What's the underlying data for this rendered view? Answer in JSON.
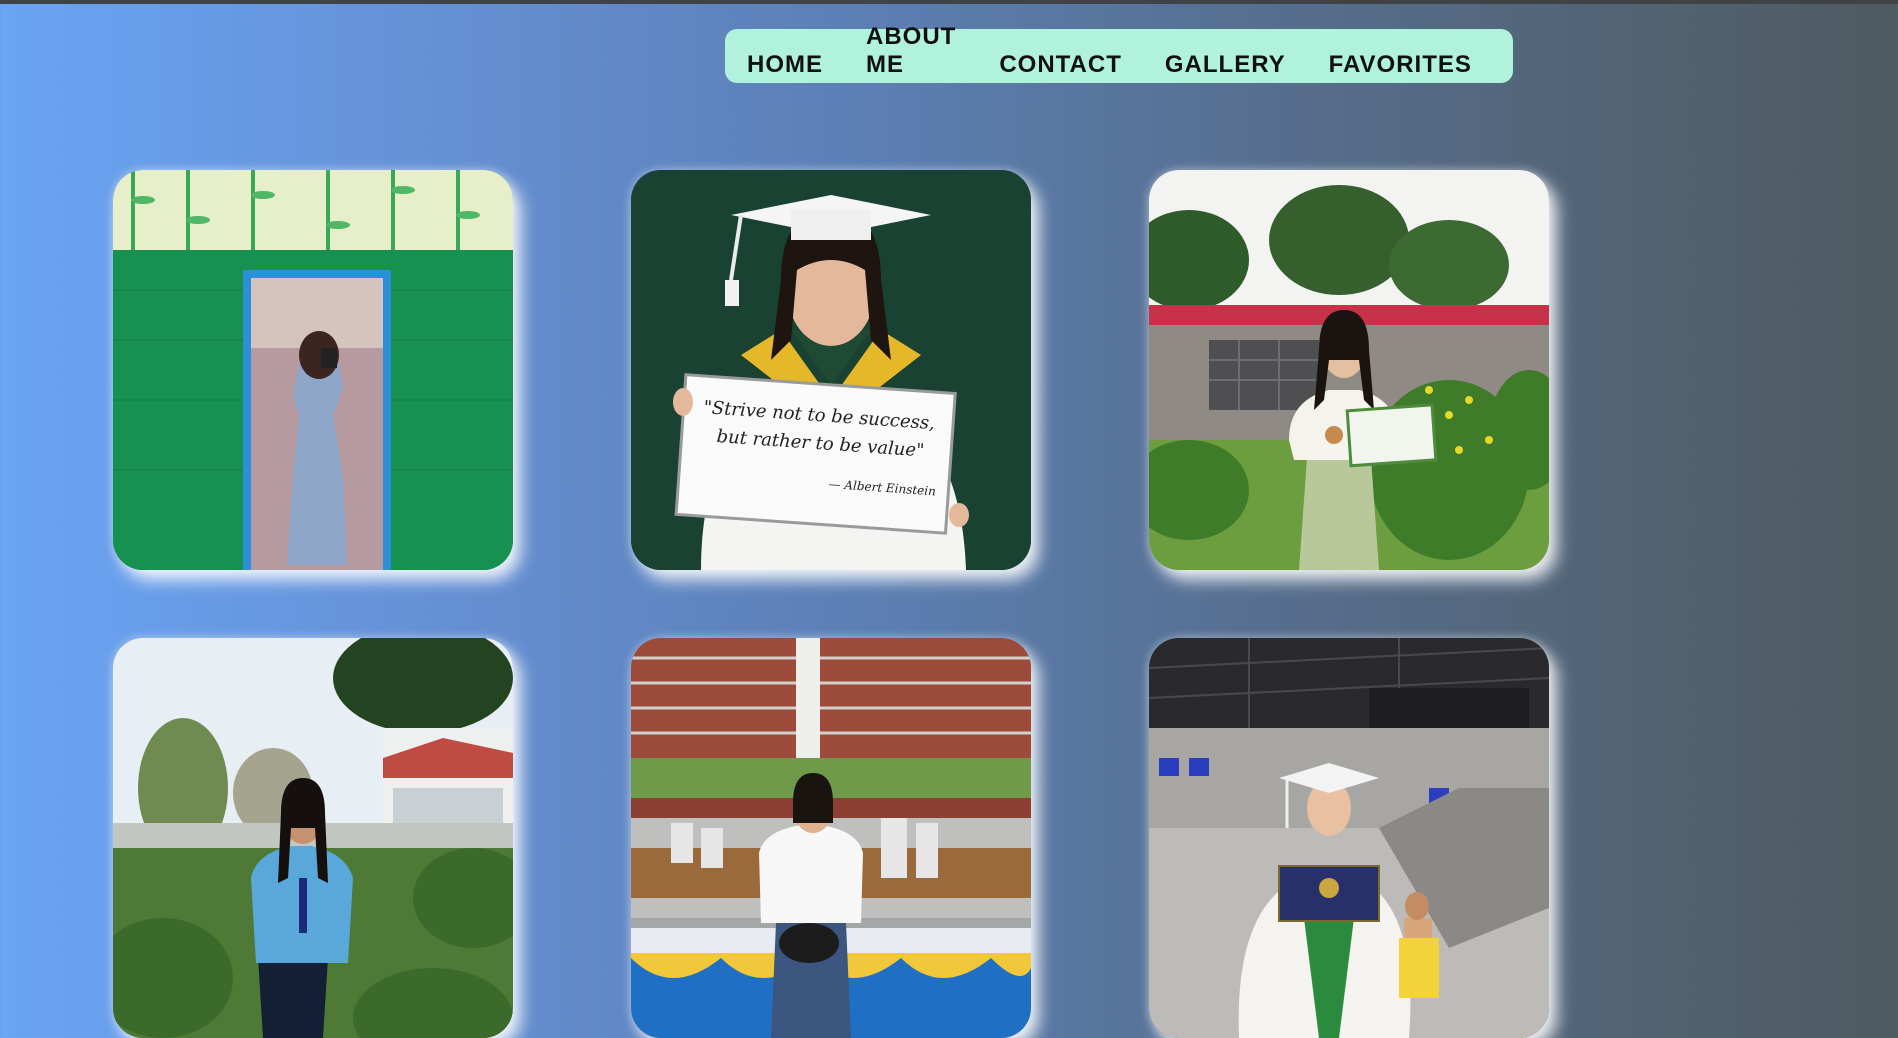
{
  "nav": {
    "items": [
      "HOME",
      "ABOUT ME",
      "CONTACT",
      "GALLERY",
      "FAVORITES"
    ]
  },
  "gallery": {
    "photo2_sign": {
      "line1": "\"Strive not to be success,",
      "line2": "but rather to be value\"",
      "author": "— Albert Einstein"
    }
  },
  "colors": {
    "nav_background": "#b1f2dc",
    "page_gradient_left": "#6aa4f4",
    "page_gradient_right": "#4e5a60"
  }
}
